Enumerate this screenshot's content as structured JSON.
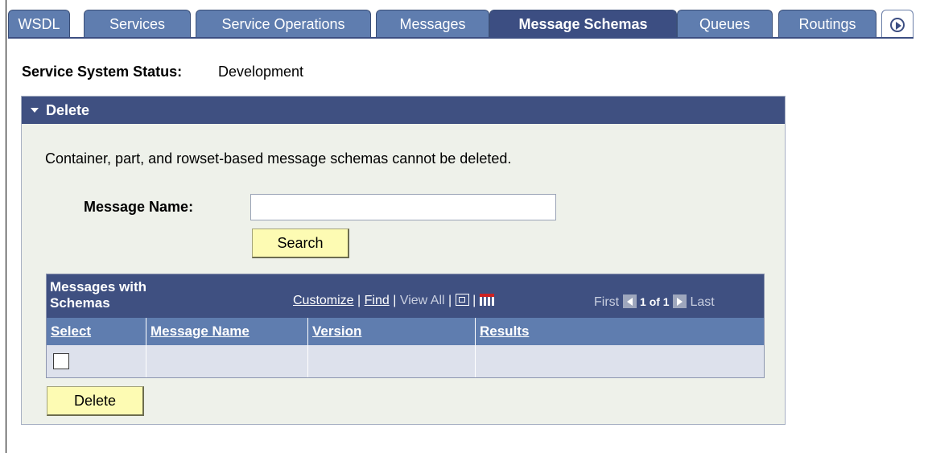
{
  "tabs": [
    {
      "label": "WSDL"
    },
    {
      "label": "Services"
    },
    {
      "label": "Service Operations"
    },
    {
      "label": "Messages"
    },
    {
      "label": "Message Schemas",
      "active": true
    },
    {
      "label": "Queues"
    },
    {
      "label": "Routings"
    }
  ],
  "status": {
    "label": "Service System Status:",
    "value": "Development"
  },
  "panel": {
    "title": "Delete",
    "info": "Container, part, and rowset-based message schemas cannot be deleted.",
    "message_name_label": "Message Name:",
    "message_name_value": "",
    "search_label": "Search",
    "delete_label": "Delete"
  },
  "grid": {
    "title": "Messages with Schemas",
    "customize": "Customize",
    "find": "Find",
    "view_all": "View All",
    "sep": "|",
    "first": "First",
    "position": "1 of 1",
    "last": "Last",
    "columns": [
      "Select",
      "Message Name",
      "Version",
      "Results"
    ],
    "rows": [
      {
        "selected": false,
        "message_name": "",
        "version": "",
        "results": ""
      }
    ]
  },
  "icons": {
    "tab_more": "next-tab-icon",
    "zoom": "zoom-grid-icon",
    "download": "download-grid-icon",
    "prev": "previous-row-icon",
    "next": "next-row-icon",
    "collapse": "collapse-caret-icon"
  },
  "colors": {
    "tab": "#5f7daf",
    "tab_active": "#3c4e82",
    "header": "#3f5081",
    "button": "#fdfbb3",
    "panel_bg": "#eef1ea"
  }
}
